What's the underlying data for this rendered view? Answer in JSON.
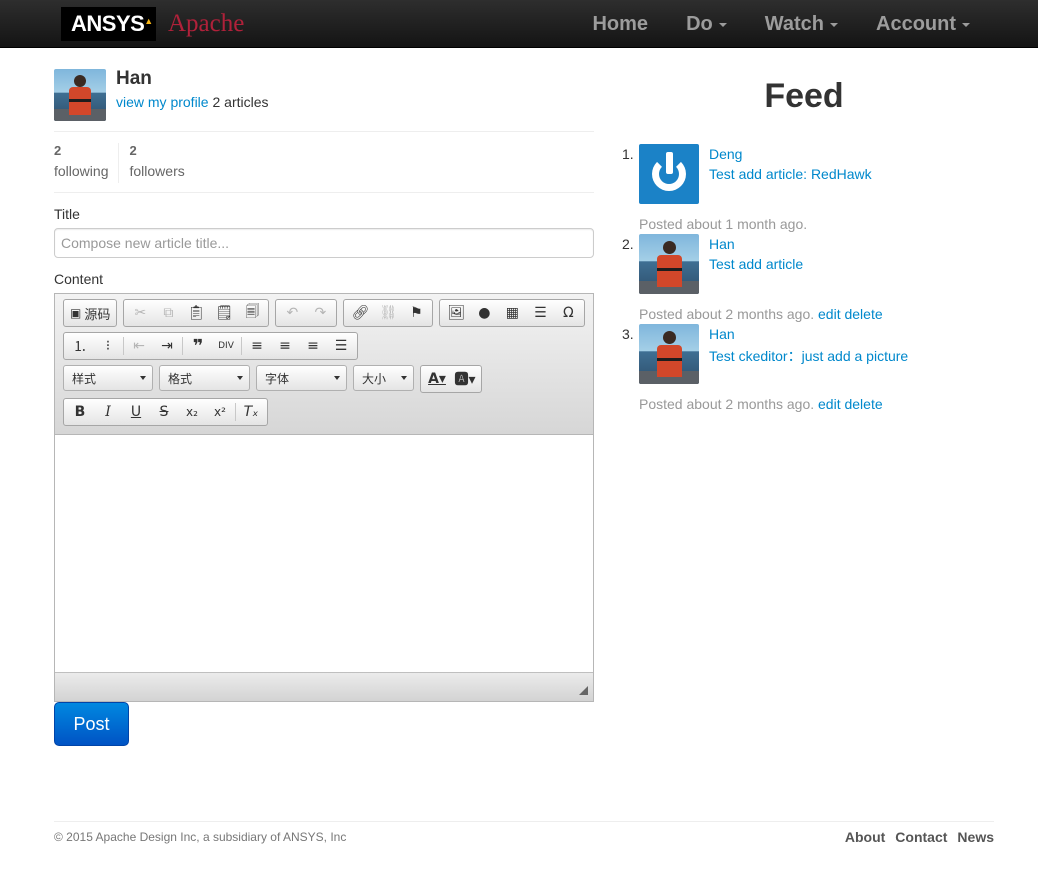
{
  "navbar": {
    "logo_text": "ANSYS",
    "brand_name": "Apache",
    "items": [
      {
        "label": "Home",
        "dropdown": false
      },
      {
        "label": "Do",
        "dropdown": true
      },
      {
        "label": "Watch",
        "dropdown": true
      },
      {
        "label": "Account",
        "dropdown": true
      }
    ]
  },
  "user": {
    "name": "Han",
    "profile_link": "view my profile",
    "articles_text": "2 articles",
    "following_count": "2",
    "following_label": "following",
    "followers_count": "2",
    "followers_label": "followers"
  },
  "form": {
    "title_label": "Title",
    "title_placeholder": "Compose new article title...",
    "title_value": "",
    "content_label": "Content",
    "submit_label": "Post"
  },
  "editor": {
    "source_label": "源码",
    "combos": [
      "样式",
      "格式",
      "字体",
      "大小"
    ]
  },
  "feed": {
    "title": "Feed",
    "items": [
      {
        "number": "1.",
        "user": "Deng",
        "content": "Test add article: RedHawk",
        "timestamp": "Posted about 1 month ago.",
        "edit": "",
        "delete": ""
      },
      {
        "number": "2.",
        "user": "Han",
        "content": "Test add article",
        "timestamp": "Posted about 2 months ago.",
        "edit": "edit",
        "delete": "delete"
      },
      {
        "number": "3.",
        "user": "Han",
        "content": "Test ckeditor：just add a picture",
        "timestamp": "Posted about 2 months ago.",
        "edit": "edit",
        "delete": "delete"
      }
    ]
  },
  "footer": {
    "copyright": "© 2015 Apache Design Inc, a subsidiary of ANSYS, Inc",
    "links": [
      "About",
      "Contact",
      "News"
    ]
  },
  "colors": {
    "navbar_bg": "#1e1e1e",
    "brand": "#b0213a",
    "link": "#0088cc",
    "post_button": "#0068d4"
  }
}
